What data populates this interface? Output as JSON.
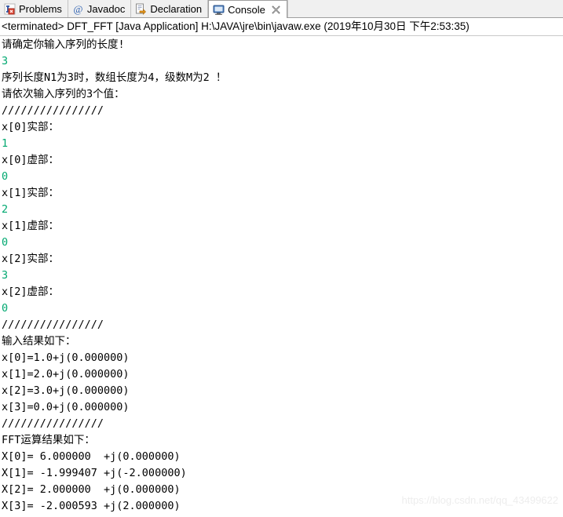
{
  "tabs": [
    {
      "label": "Problems",
      "icon": "problems-icon",
      "active": false,
      "closable": false
    },
    {
      "label": "Javadoc",
      "icon": "javadoc-at-icon",
      "active": false,
      "closable": false
    },
    {
      "label": "Declaration",
      "icon": "declaration-icon",
      "active": false,
      "closable": false
    },
    {
      "label": "Console",
      "icon": "console-monitor-icon",
      "active": true,
      "closable": true
    }
  ],
  "launch": {
    "text": "<terminated> DFT_FFT [Java Application] H:\\JAVA\\jre\\bin\\javaw.exe (2019年10月30日 下午2:53:35)"
  },
  "console": {
    "input_color": "#00a870",
    "output_color": "#000000",
    "lines": [
      {
        "text": "请确定你输入序列的长度!",
        "kind": "output"
      },
      {
        "text": "3",
        "kind": "input"
      },
      {
        "text": "序列长度N1为3时，数组长度为4，级数M为2 ！",
        "kind": "output"
      },
      {
        "text": "请依次输入序列的3个值：",
        "kind": "output"
      },
      {
        "text": "////////////////",
        "kind": "output"
      },
      {
        "text": "x[0]实部：",
        "kind": "output"
      },
      {
        "text": "1",
        "kind": "input"
      },
      {
        "text": "x[0]虚部：",
        "kind": "output"
      },
      {
        "text": "0",
        "kind": "input"
      },
      {
        "text": "x[1]实部：",
        "kind": "output"
      },
      {
        "text": "2",
        "kind": "input"
      },
      {
        "text": "x[1]虚部：",
        "kind": "output"
      },
      {
        "text": "0",
        "kind": "input"
      },
      {
        "text": "x[2]实部：",
        "kind": "output"
      },
      {
        "text": "3",
        "kind": "input"
      },
      {
        "text": "x[2]虚部：",
        "kind": "output"
      },
      {
        "text": "0",
        "kind": "input"
      },
      {
        "text": "////////////////",
        "kind": "output"
      },
      {
        "text": "输入结果如下：",
        "kind": "output"
      },
      {
        "text": "x[0]=1.0+j(0.000000)",
        "kind": "output"
      },
      {
        "text": "x[1]=2.0+j(0.000000)",
        "kind": "output"
      },
      {
        "text": "x[2]=3.0+j(0.000000)",
        "kind": "output"
      },
      {
        "text": "x[3]=0.0+j(0.000000)",
        "kind": "output"
      },
      {
        "text": "////////////////",
        "kind": "output"
      },
      {
        "text": "FFT运算结果如下：",
        "kind": "output"
      },
      {
        "text": "X[0]= 6.000000  +j(0.000000)",
        "kind": "output"
      },
      {
        "text": "X[1]= -1.999407 +j(-2.000000)",
        "kind": "output"
      },
      {
        "text": "X[2]= 2.000000  +j(0.000000)",
        "kind": "output"
      },
      {
        "text": "X[3]= -2.000593 +j(2.000000)",
        "kind": "output"
      }
    ]
  },
  "watermark": {
    "text": "https://blog.csdn.net/qq_43499622"
  }
}
